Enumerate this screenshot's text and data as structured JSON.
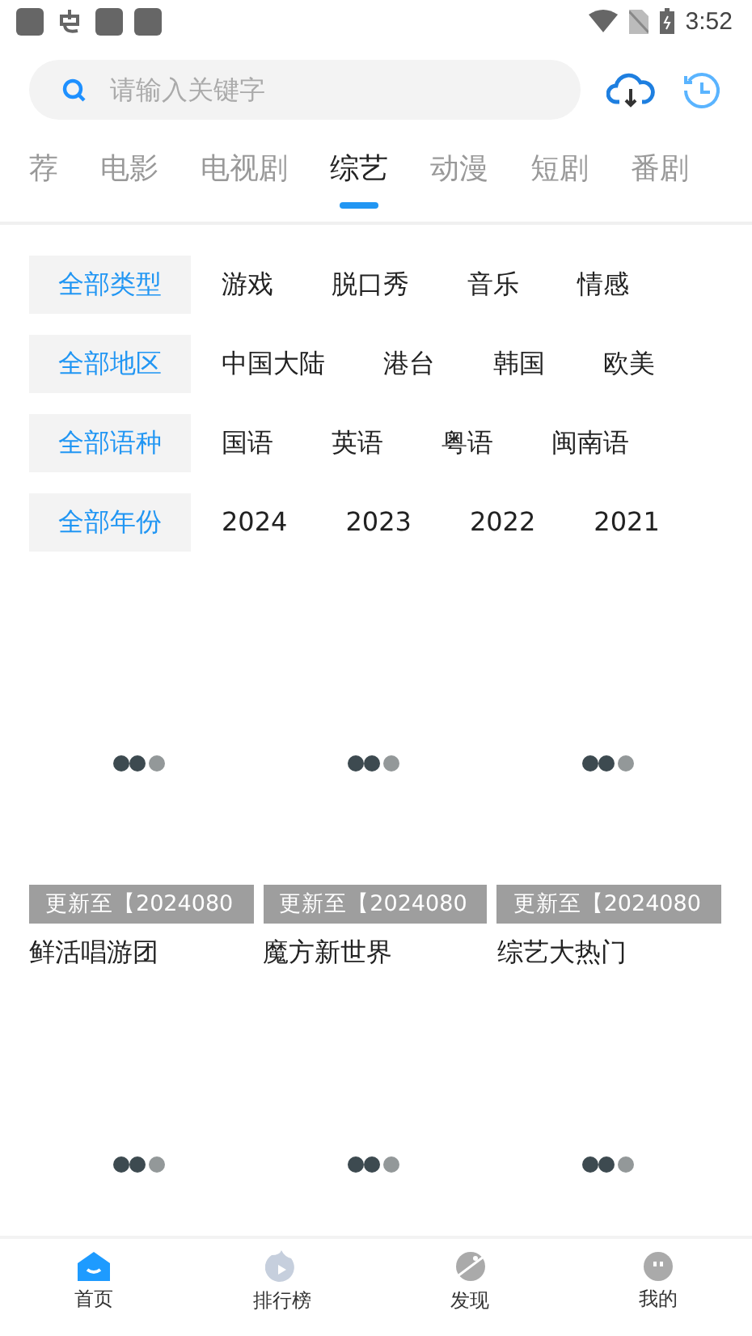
{
  "status_bar": {
    "time": "3:52"
  },
  "search": {
    "placeholder": "请输入关键字"
  },
  "tabs": [
    {
      "label": "荐",
      "selected": false
    },
    {
      "label": "电影",
      "selected": false
    },
    {
      "label": "电视剧",
      "selected": false
    },
    {
      "label": "综艺",
      "selected": true
    },
    {
      "label": "动漫",
      "selected": false
    },
    {
      "label": "短剧",
      "selected": false
    },
    {
      "label": "番剧",
      "selected": false
    }
  ],
  "filters": [
    {
      "options": [
        {
          "label": "全部类型",
          "selected": true
        },
        {
          "label": "游戏",
          "selected": false
        },
        {
          "label": "脱口秀",
          "selected": false
        },
        {
          "label": "音乐",
          "selected": false
        },
        {
          "label": "情感",
          "selected": false
        }
      ]
    },
    {
      "options": [
        {
          "label": "全部地区",
          "selected": true
        },
        {
          "label": "中国大陆",
          "selected": false
        },
        {
          "label": "港台",
          "selected": false
        },
        {
          "label": "韩国",
          "selected": false
        },
        {
          "label": "欧美",
          "selected": false
        }
      ]
    },
    {
      "options": [
        {
          "label": "全部语种",
          "selected": true
        },
        {
          "label": "国语",
          "selected": false
        },
        {
          "label": "英语",
          "selected": false
        },
        {
          "label": "粤语",
          "selected": false
        },
        {
          "label": "闽南语",
          "selected": false
        }
      ]
    },
    {
      "options": [
        {
          "label": "全部年份",
          "selected": true
        },
        {
          "label": "2024",
          "selected": false
        },
        {
          "label": "2023",
          "selected": false
        },
        {
          "label": "2022",
          "selected": false
        },
        {
          "label": "2021",
          "selected": false
        }
      ]
    }
  ],
  "shows": [
    {
      "kind": "show",
      "badge": "更新至【2024080",
      "title": "鲜活唱游团"
    },
    {
      "kind": "show",
      "badge": "更新至【2024080",
      "title": "魔方新世界"
    },
    {
      "kind": "show",
      "badge": "更新至【2024080",
      "title": "综艺大热门"
    },
    {
      "kind": "loading"
    },
    {
      "kind": "loading"
    },
    {
      "kind": "loading"
    }
  ],
  "bottom_nav": [
    {
      "label": "首页",
      "selected": true,
      "kind": "home"
    },
    {
      "label": "排行榜",
      "selected": false,
      "kind": "rank"
    },
    {
      "label": "发现",
      "selected": false,
      "kind": "discover"
    },
    {
      "label": "我的",
      "selected": false,
      "kind": "me"
    }
  ]
}
